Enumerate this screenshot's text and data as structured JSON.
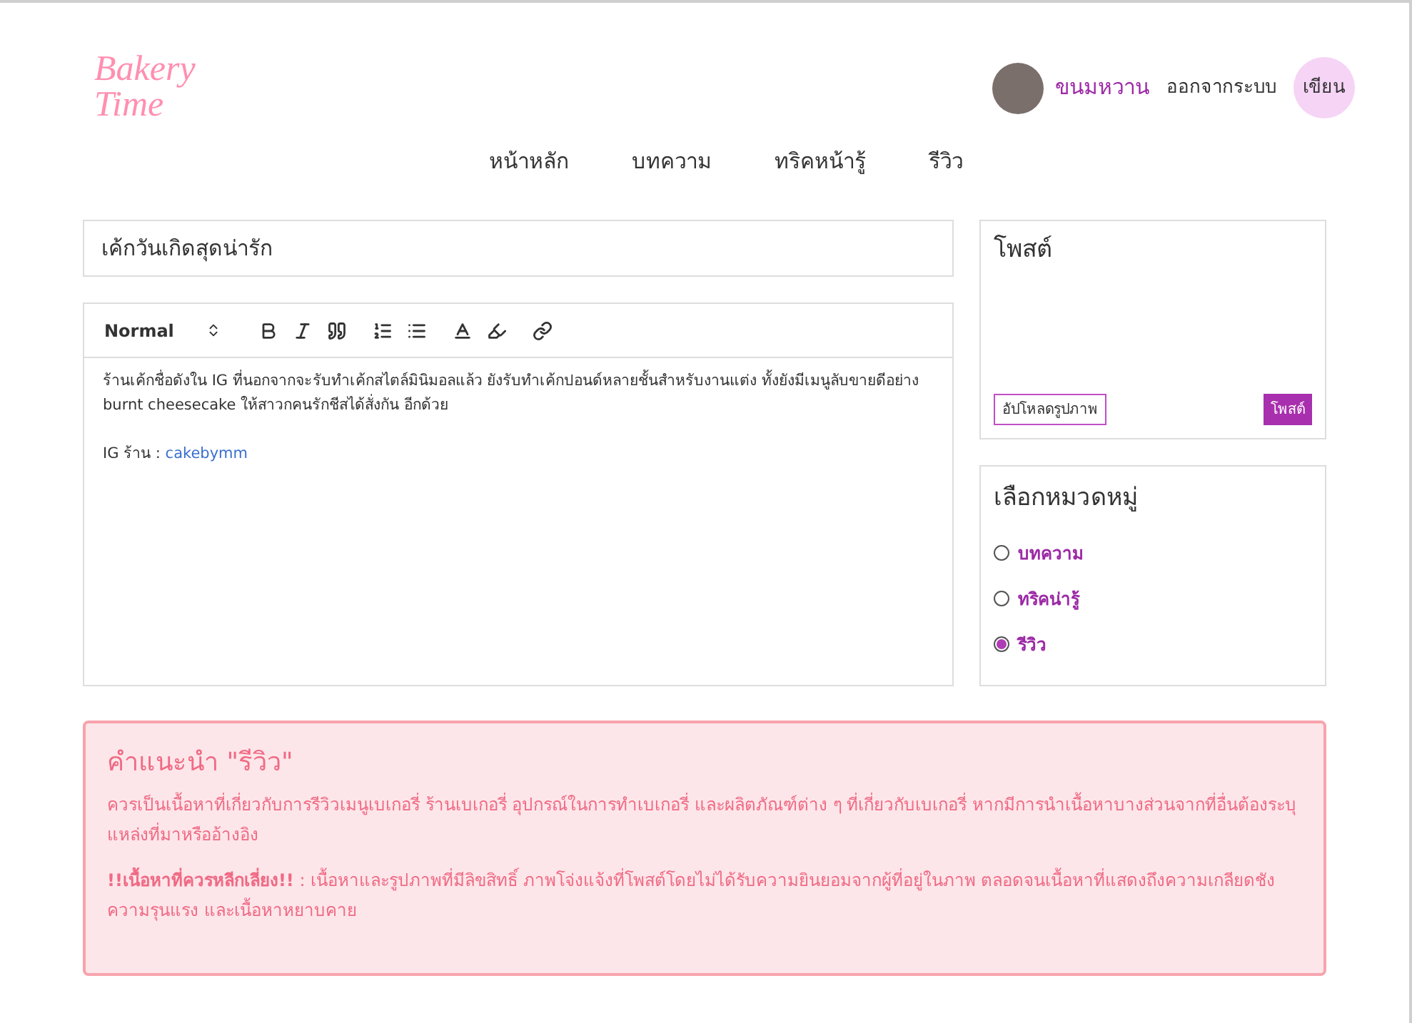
{
  "logo": "Bakery Time",
  "user": {
    "name": "ขนมหวาน",
    "logout": "ออกจากระบบ",
    "write_button": "เขียน"
  },
  "nav": [
    {
      "label": "หน้าหลัก"
    },
    {
      "label": "บทความ"
    },
    {
      "label": "ทริคหน้ารู้"
    },
    {
      "label": "รีวิว"
    }
  ],
  "title_field": {
    "value": "เค้กวันเกิดสุดน่ารัก"
  },
  "editor": {
    "format_select": "Normal",
    "paragraph": "ร้านเค้กชื่อดังใน IG ที่นอกจากจะรับทำเค้กสไตล์มินิมอลแล้ว ยังรับทำเค้กปอนด์หลายชั้นสำหรับงานแต่ง ทั้งยังมีเมนูลับขายดีอย่าง burnt cheesecake ให้สาวกคนรักชีสได้สั่งกัน อีกด้วย",
    "ig_label": "IG ร้าน :",
    "ig_link": "cakebymm"
  },
  "post_panel": {
    "title": "โพสต์",
    "upload_button": "อัปโหลดรูปภาพ",
    "post_button": "โพสต์"
  },
  "category_panel": {
    "title": "เลือกหมวดหมู่",
    "options": [
      {
        "label": "บทความ",
        "selected": false
      },
      {
        "label": "ทริคน่ารู้",
        "selected": false
      },
      {
        "label": "รีวิว",
        "selected": true
      }
    ]
  },
  "notice": {
    "title": "คำแนะนำ \"รีวิว\"",
    "paragraphs": [
      "ควรเป็นเนื้อหาที่เกี่ยวกับการรีวิวเมนูเบเกอรี่ ร้านเบเกอรี่ อุปกรณ์ในการทำเบเกอรี่ และผลิตภัณฑ์ต่าง ๆ ที่เกี่ยวกับเบเกอรี่ หากมีการนำเนื้อหาบางส่วนจากที่อื่นต้องระบุแหล่งที่มาหรืออ้างอิง",
      "**!!เนื้อหาที่ควรหลีกเลี่ยง!!** : เนื้อหาและรูปภาพที่มีลิขสิทธิ์ ภาพโจ่งแจ้งที่โพสต์โดยไม่ได้รับความยินยอมจากผู้ที่อยู่ในภาพ ตลอดจนเนื้อหาที่แสดงถึงความเกลียดชัง ความรุนแรง และเนื้อหาหยาบคาย"
    ]
  }
}
